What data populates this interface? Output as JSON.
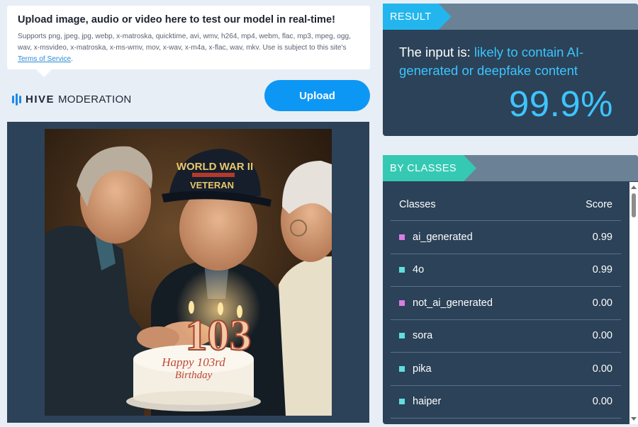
{
  "upload": {
    "title": "Upload image, audio or video here to test our model in real-time!",
    "description_prefix": "Supports png, jpeg, jpg, webp, x-matroska, quicktime, avi, wmv, h264, mp4, webm, flac, mp3, mpeg, ogg, wav, x-msvideo, x-matroska, x-ms-wmv, mov, x-wav, x-m4a, x-flac, wav, mkv. Use is subject to this site's ",
    "terms_link": "Terms of Service",
    "description_suffix": ".",
    "button_label": "Upload"
  },
  "logo": {
    "brand": "HIVE",
    "product": "MODERATION"
  },
  "preview": {
    "cake_number": "103",
    "cake_text_line1": "Happy 103rd",
    "cake_text_line2": "Birthday",
    "cap_text_line1": "WORLD WAR II",
    "cap_text_line2": "VETERAN"
  },
  "result": {
    "tag": "RESULT",
    "prefix": "The input is: ",
    "verdict": "likely to contain AI-generated or deepfake content",
    "percentage": "99.9%",
    "accent_color": "#3cc4ff"
  },
  "classes": {
    "tag": "BY CLASSES",
    "header_classes": "Classes",
    "header_score": "Score",
    "rows": [
      {
        "name": "ai_generated",
        "score": "0.99",
        "color": "#d97ce6"
      },
      {
        "name": "4o",
        "score": "0.99",
        "color": "#5fe0dc"
      },
      {
        "name": "not_ai_generated",
        "score": "0.00",
        "color": "#d97ce6"
      },
      {
        "name": "sora",
        "score": "0.00",
        "color": "#5fe0dc"
      },
      {
        "name": "pika",
        "score": "0.00",
        "color": "#5fe0dc"
      },
      {
        "name": "haiper",
        "score": "0.00",
        "color": "#5fe0dc"
      }
    ]
  },
  "colors": {
    "primary_button": "#0d97f5",
    "panel_bg": "#2b4258",
    "result_tag": "#23b6ee",
    "classes_tag": "#35c9b3"
  }
}
